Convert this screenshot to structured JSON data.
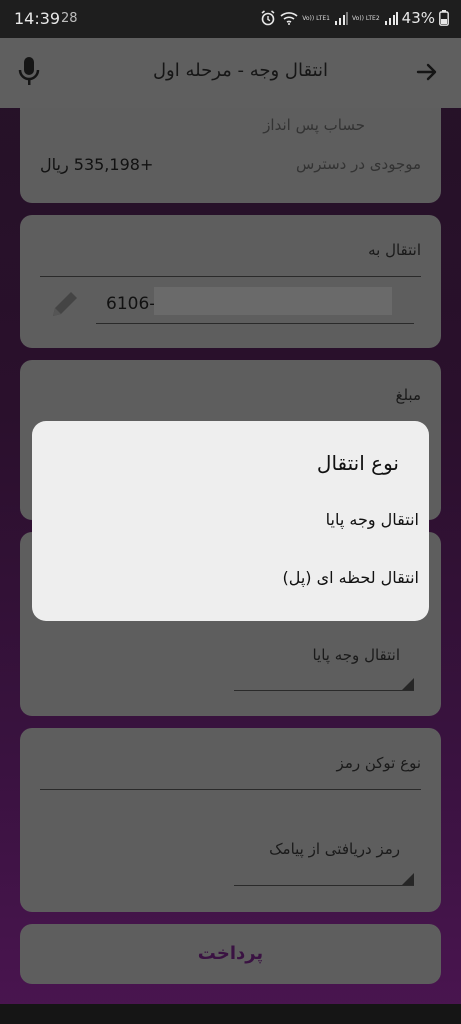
{
  "status_bar": {
    "time": "14:39",
    "date": "28",
    "battery": "43%",
    "net1": "Vo)) LTE1",
    "net2": "Vo)) LTE2"
  },
  "toolbar": {
    "title": "انتقال وجه - مرحله اول"
  },
  "account_card": {
    "account_name": "حساب پس انداز",
    "balance_label": "موجودی در دسترس",
    "balance_value": "+535,198 ریال"
  },
  "transfer_to_card": {
    "label": "انتقال به",
    "value": "6106-"
  },
  "amount_card": {
    "label": "مبلغ"
  },
  "transfer_type_card": {
    "selected": "انتقال وجه پایا"
  },
  "token_card": {
    "label": "نوع توکن رمز",
    "selected": "رمز دریافتی از پیامک"
  },
  "pay_button": {
    "label": "پرداخت"
  },
  "dialog": {
    "title": "نوع انتقال",
    "options": [
      "انتقال وجه پایا",
      "انتقال لحظه ای (پل)"
    ]
  }
}
